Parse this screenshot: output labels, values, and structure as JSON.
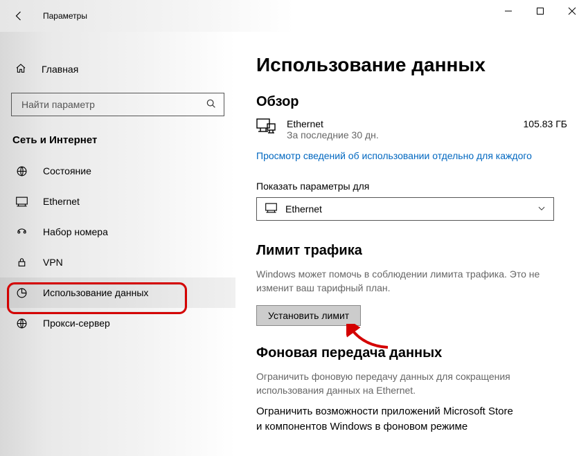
{
  "titlebar": {
    "title": "Параметры"
  },
  "sidebar": {
    "home_label": "Главная",
    "search_placeholder": "Найти параметр",
    "category": "Сеть и Интернет",
    "items": [
      {
        "label": "Состояние"
      },
      {
        "label": "Ethernet"
      },
      {
        "label": "Набор номера"
      },
      {
        "label": "VPN"
      },
      {
        "label": "Использование данных"
      },
      {
        "label": "Прокси-сервер"
      }
    ]
  },
  "main": {
    "page_title": "Использование данных",
    "overview_heading": "Обзор",
    "network_name": "Ethernet",
    "network_period": "За последние 30 дн.",
    "network_usage": "105.83 ГБ",
    "usage_link": "Просмотр сведений об использовании отдельно для каждого",
    "show_for_label": "Показать параметры для",
    "show_for_value": "Ethernet",
    "limit_heading": "Лимит трафика",
    "limit_desc": "Windows может помочь в соблюдении лимита трафика. Это не изменит ваш тарифный план.",
    "set_limit_button": "Установить лимит",
    "background_heading": "Фоновая передача данных",
    "background_desc": "Ограничить фоновую передачу данных для сокращения использования данных на Ethernet.",
    "background_body": "Ограничить возможности приложений Microsoft Store и компонентов Windows в фоновом режиме"
  }
}
